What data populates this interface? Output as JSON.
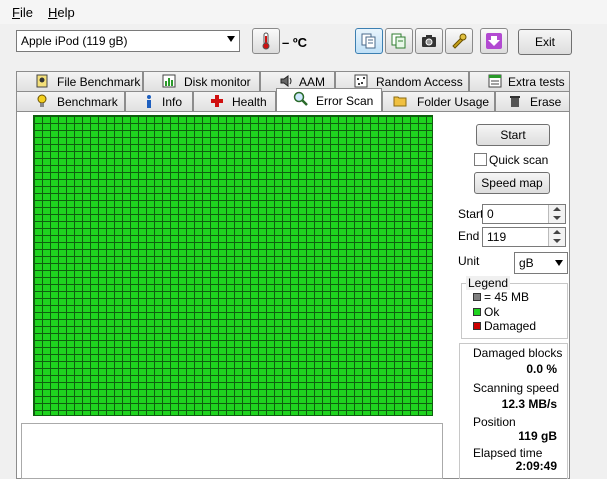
{
  "menu": {
    "file_first": "F",
    "file_rest": "ile",
    "help_first": "H",
    "help_rest": "elp"
  },
  "drive": {
    "selected": "Apple   iPod (119 gB)"
  },
  "temperature": {
    "text": "– ºC"
  },
  "toolbar": {
    "exit_label": "Exit"
  },
  "tabs": {
    "top": [
      "File Benchmark",
      "Disk monitor",
      "AAM",
      "Random Access",
      "Extra tests"
    ],
    "bottom": [
      "Benchmark",
      "Info",
      "Health",
      "Error Scan",
      "Folder Usage",
      "Erase"
    ],
    "selected": "Error Scan"
  },
  "controls": {
    "start_button": "Start",
    "quick_scan": "Quick scan",
    "speed_map_button": "Speed map",
    "start_label": "Start",
    "start_value": "0",
    "end_label": "End",
    "end_value": "119",
    "unit_label": "Unit",
    "unit_value": "gB"
  },
  "legend": {
    "title": "Legend",
    "items": [
      {
        "label": "= 45 MB",
        "color": "#808080"
      },
      {
        "label": "Ok",
        "color": "#1fd31f"
      },
      {
        "label": "Damaged",
        "color": "#cc0000"
      }
    ]
  },
  "stats": {
    "damaged_label": "Damaged blocks",
    "damaged_value": "0.0 %",
    "speed_label": "Scanning speed",
    "speed_value": "12.3 MB/s",
    "position_label": "Position",
    "position_value": "119 gB",
    "elapsed_label": "Elapsed time",
    "elapsed_value": "2:09:49"
  },
  "colors": {
    "ok": "#1fd31f",
    "grid_line": "#0f5f0f",
    "damaged": "#cc0000"
  }
}
